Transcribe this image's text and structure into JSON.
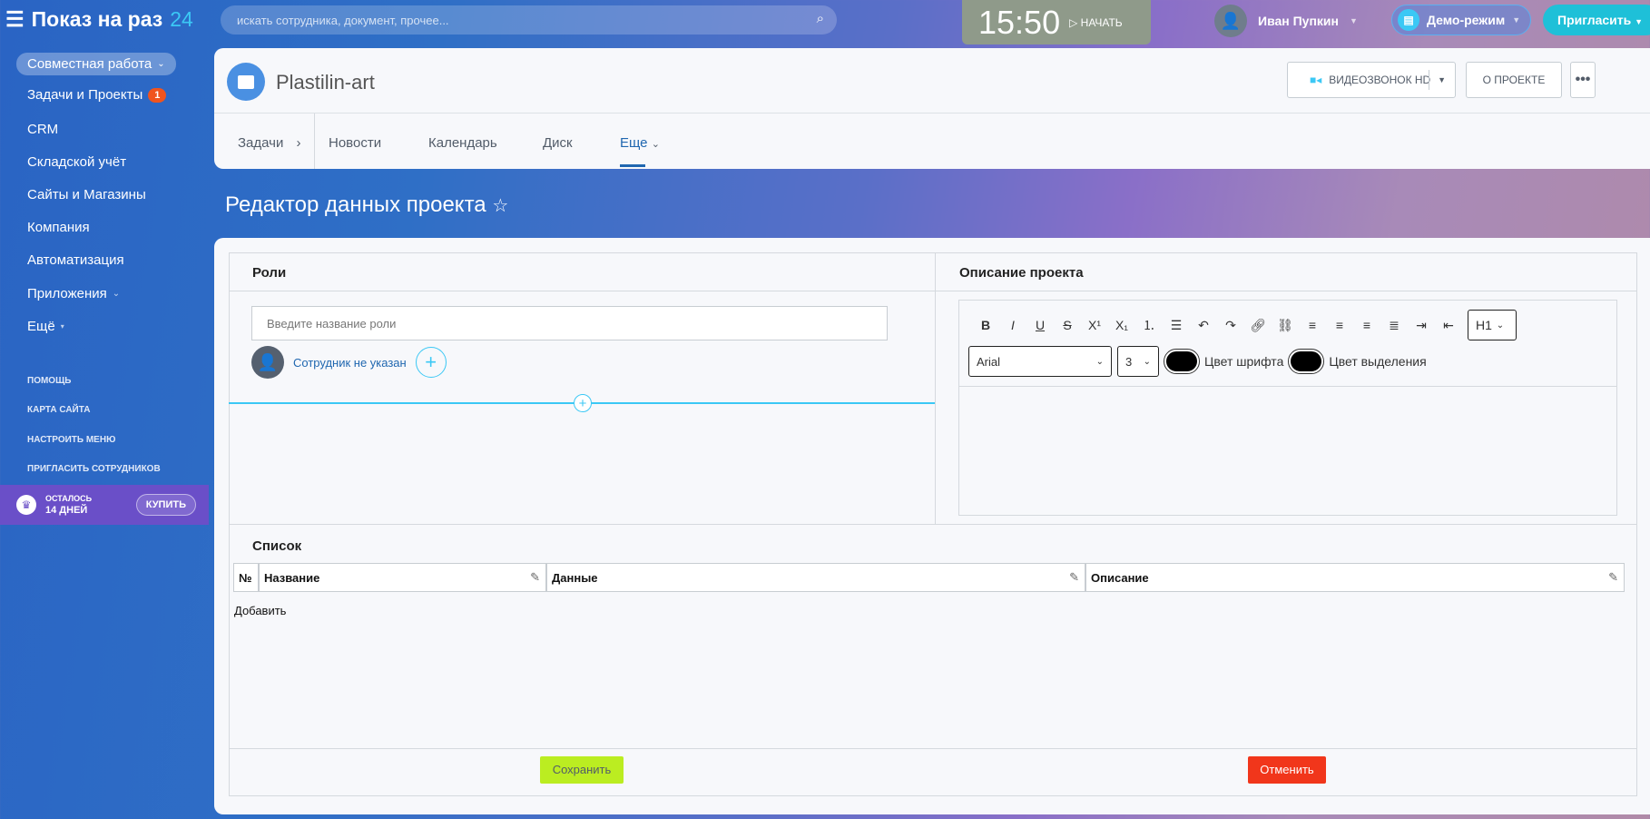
{
  "topbar": {
    "logo_main": "Показ на раз",
    "logo_num": "24",
    "search_placeholder": "искать сотрудника, документ, прочее...",
    "clock": "15:50",
    "start": "НАЧАТЬ",
    "user": "Иван Пупкин",
    "demo": "Демо-режим",
    "invite": "Пригласить"
  },
  "sidebar": {
    "group": "Совместная работа",
    "items": [
      {
        "label": "Задачи и Проекты",
        "badge": "1"
      },
      {
        "label": "CRM"
      },
      {
        "label": "Складской учёт"
      },
      {
        "label": "Сайты и Магазины"
      },
      {
        "label": "Компания"
      },
      {
        "label": "Автоматизация"
      },
      {
        "label": "Приложения"
      },
      {
        "label": "Ещё"
      }
    ],
    "links": [
      "ПОМОЩЬ",
      "КАРТА САЙТА",
      "НАСТРОИТЬ МЕНЮ",
      "ПРИГЛАСИТЬ СОТРУДНИКОВ"
    ],
    "trial": {
      "line1": "ОСТАЛОСЬ",
      "line2": "14 ДНЕЙ",
      "buy": "КУПИТЬ"
    }
  },
  "header": {
    "title": "Plastilin-art",
    "video": "ВИДЕОЗВОНОК HD",
    "about": "О ПРОЕКТЕ",
    "tabs": [
      "Задачи",
      "Новости",
      "Календарь",
      "Диск",
      "Еще"
    ]
  },
  "page": {
    "title": "Редактор данных проекта"
  },
  "roles": {
    "title": "Роли",
    "placeholder": "Введите название роли",
    "employee": "Сотрудник не указан"
  },
  "description": {
    "title": "Описание проекта",
    "heading": "H1",
    "font": "Arial",
    "size": "3",
    "font_color": "Цвет шрифта",
    "highlight_color": "Цвет выделения"
  },
  "list": {
    "title": "Список",
    "columns": [
      "№",
      "Название",
      "Данные",
      "Описание"
    ],
    "add": "Добавить"
  },
  "footer": {
    "save": "Сохранить",
    "cancel": "Отменить"
  }
}
